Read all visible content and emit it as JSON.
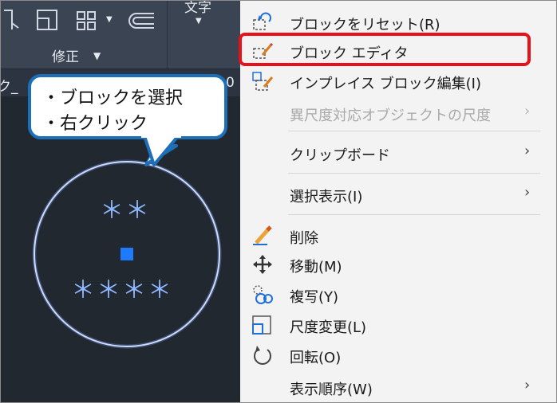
{
  "ribbon": {
    "panel_label": "修正",
    "text_panel": "文字"
  },
  "tab": {
    "label_left": "ク_",
    "label_right": "0"
  },
  "callout": {
    "lines": [
      "・ブロックを選択",
      "・右クリック"
    ]
  },
  "drawing": {
    "top_row": "＊＊",
    "bottom_row": "＊＊＊＊"
  },
  "menu": {
    "items": [
      {
        "label": "ブロックをリセット(R)",
        "icon": "block-reset-icon",
        "enabled": true,
        "submenu": false
      },
      {
        "label": "ブロック エディタ",
        "icon": "block-editor-icon",
        "enabled": true,
        "submenu": false
      },
      {
        "label": "インプレイス ブロック編集(I)",
        "icon": "inplace-edit-icon",
        "enabled": true,
        "submenu": false
      },
      {
        "label": "異尺度対応オブジェクトの尺度",
        "icon": "",
        "enabled": false,
        "submenu": true
      },
      {
        "label": "クリップボード",
        "icon": "",
        "enabled": true,
        "submenu": true
      },
      {
        "label": "選択表示(I)",
        "icon": "",
        "enabled": true,
        "submenu": true
      },
      {
        "label": "削除",
        "icon": "eraser-icon",
        "enabled": true,
        "submenu": false
      },
      {
        "label": "移動(M)",
        "icon": "move-icon",
        "enabled": true,
        "submenu": false
      },
      {
        "label": "複写(Y)",
        "icon": "copy-icon",
        "enabled": true,
        "submenu": false
      },
      {
        "label": "尺度変更(L)",
        "icon": "scale-icon",
        "enabled": true,
        "submenu": false
      },
      {
        "label": "回転(O)",
        "icon": "rotate-icon",
        "enabled": true,
        "submenu": false
      },
      {
        "label": "表示順序(W)",
        "icon": "",
        "enabled": true,
        "submenu": true
      }
    ],
    "highlighted_item": "ブロック エディタ",
    "submenu_arrow": "›"
  },
  "colors": {
    "highlight": "#e8111a",
    "callout_border": "#1d6fb8",
    "drawing_line": "#8fb6ff",
    "grip": "#1e7bff"
  }
}
